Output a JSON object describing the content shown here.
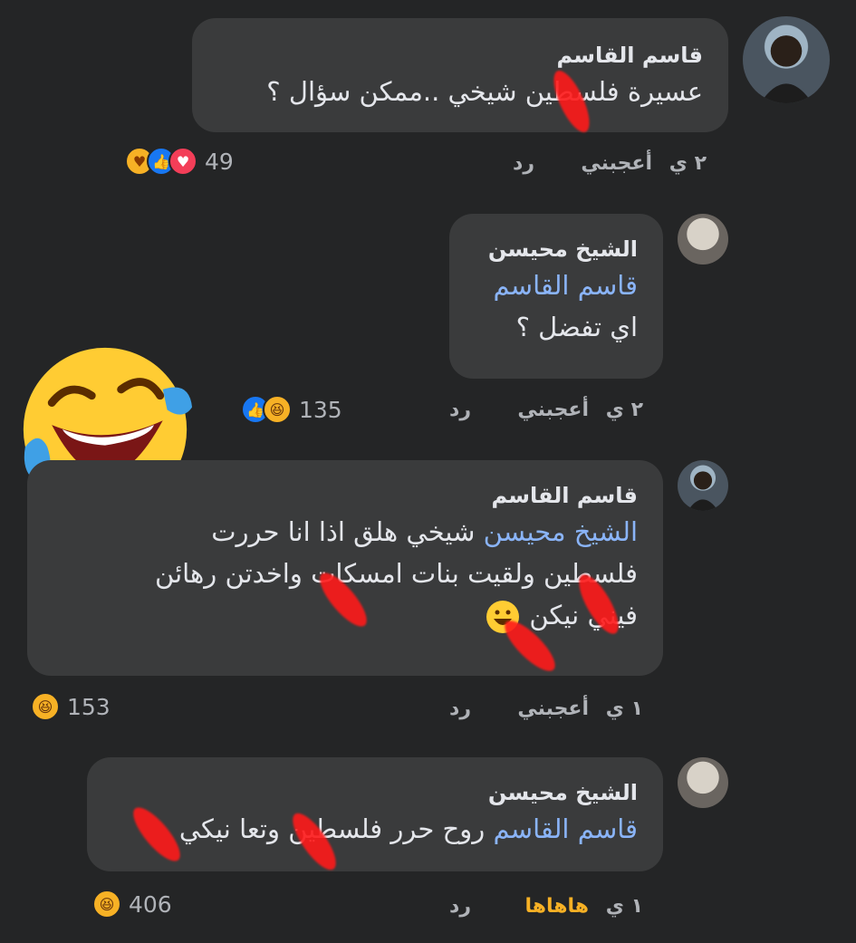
{
  "comments": [
    {
      "author": "قاسم القاسم",
      "text": "عسيرة فلسطين شيخي ..ممكن سؤال ؟",
      "time": "٢ ي",
      "like": "أعجبني",
      "reply": "رد",
      "reaction_count": "49",
      "reactions": [
        "care-icon",
        "like-icon",
        "love-icon"
      ]
    },
    {
      "author": "الشيخ محيسن",
      "mention": "قاسم القاسم",
      "text": "اي تفضل ؟",
      "time": "٢ ي",
      "like": "أعجبني",
      "reply": "رد",
      "reaction_count": "135",
      "reactions": [
        "like-icon",
        "haha-icon"
      ]
    },
    {
      "author": "قاسم القاسم",
      "mention": "الشيخ محيسن",
      "text_line1": "شيخي هلق اذا انا حررت",
      "text_line2": "فلسطين ولقيت بنات امسكات واخدتن رهائن",
      "text_line3": "فيني نيكن",
      "time": "١ ي",
      "like": "أعجبني",
      "reply": "رد",
      "reaction_count": "153",
      "reactions": [
        "haha-icon"
      ]
    },
    {
      "author": "الشيخ محيسن",
      "mention": "قاسم القاسم",
      "text": "روح حرر فلسطين وتعا نيكي",
      "time": "١ ي",
      "like": "هاهاها",
      "reply": "رد",
      "reaction_count": "406",
      "reactions": [
        "haha-icon"
      ]
    }
  ],
  "colors": {
    "background": "#242526",
    "bubble": "#3a3b3c",
    "mention": "#8ab4f8",
    "haha_active": "#f7b125",
    "scribble": "#ff1a1a"
  }
}
